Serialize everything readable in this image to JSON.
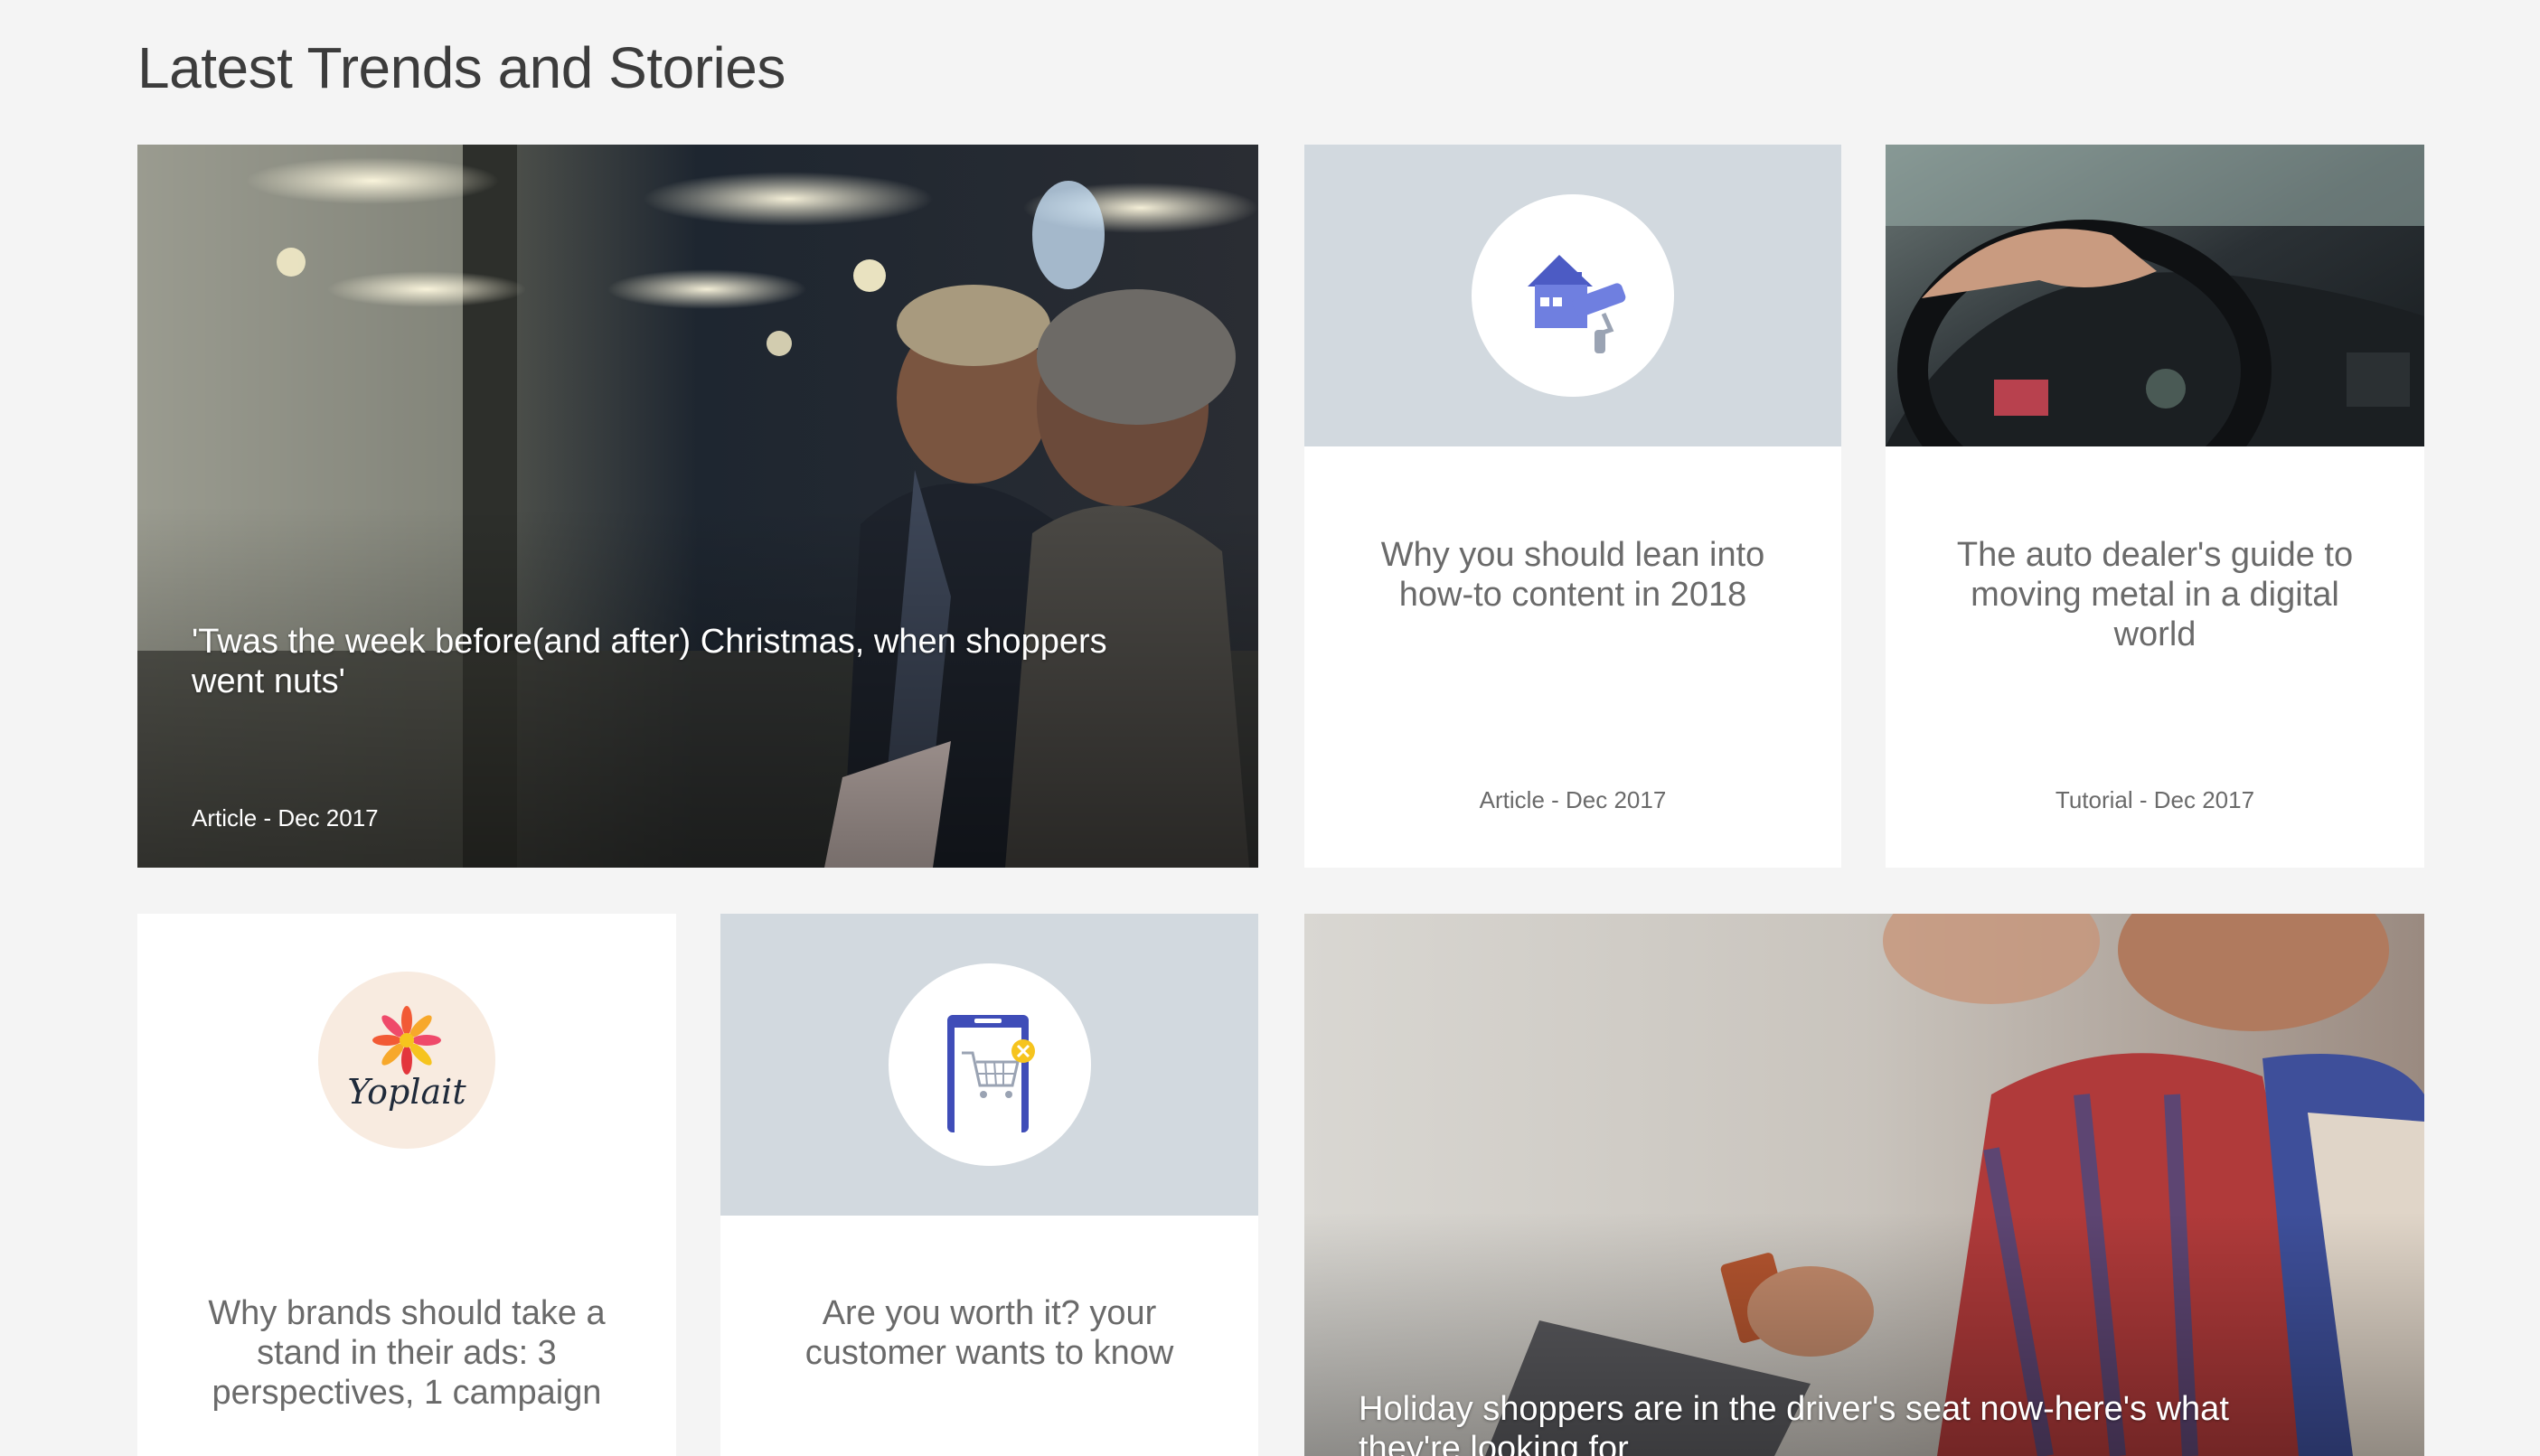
{
  "page": {
    "heading": "Latest Trends and Stories"
  },
  "cards": [
    {
      "title": "'Twas the week before(and after) Christmas, when shoppers went nuts'",
      "meta": "Article - Dec 2017",
      "image": "christmas-shopping-photo"
    },
    {
      "title": "Why you should lean into how-to content in 2018",
      "meta": "Article - Dec 2017",
      "icon": "house-paint-roller-icon"
    },
    {
      "title": "The auto dealer's guide to moving metal in a digital world",
      "meta": "Tutorial - Dec 2017",
      "image": "car-dashboard-photo"
    },
    {
      "title": "Why brands should take a stand in their ads: 3 perspectives, 1 campaign",
      "logo_text": "Yoplait",
      "icon": "yoplait-logo"
    },
    {
      "title": "Are you worth it? your customer wants to know",
      "icon": "mobile-shopping-cart-icon"
    },
    {
      "title": "Holiday shoppers are in the driver's seat now-here's what they're looking for",
      "image": "shoppers-credit-card-photo"
    }
  ],
  "colors": {
    "background": "#f4f4f4",
    "card": "#ffffff",
    "icon_panel": "#d2d9df",
    "icon_blue": "#4c5bc4",
    "text_gray": "#6a6a6a"
  }
}
